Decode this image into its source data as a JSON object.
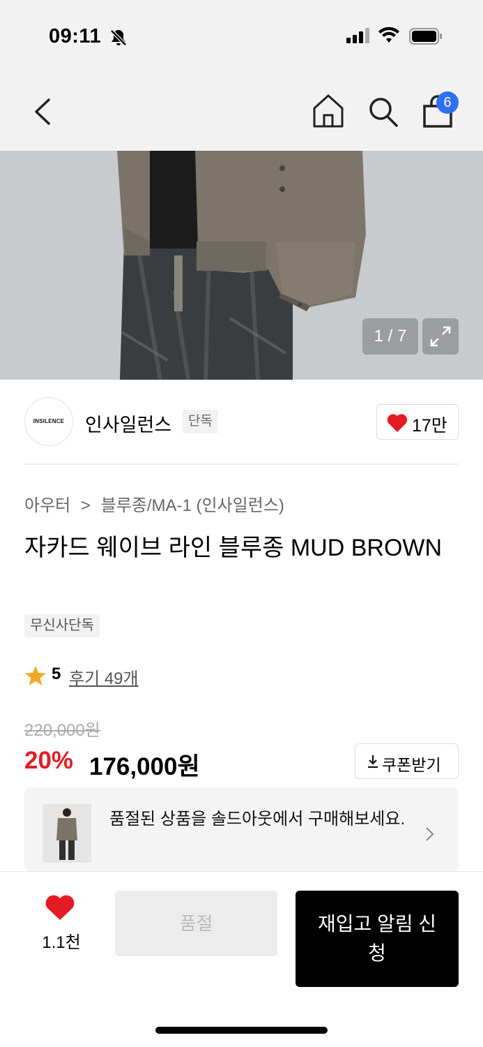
{
  "status_bar": {
    "time": "09:11"
  },
  "nav": {
    "cart_count": "6"
  },
  "gallery": {
    "page_indicator": "1 / 7"
  },
  "brand": {
    "logo_text": "INSILENCE",
    "name": "인사일런스",
    "tag": "단독",
    "like_count": "17만"
  },
  "product": {
    "breadcrumb": [
      "아우터",
      "블루종/MA-1 (인사일런스)"
    ],
    "breadcrumb_separator": ">",
    "title": "자카드 웨이브 라인 블루종 MUD BROWN",
    "badge": "무신사단독",
    "rating": "5",
    "reviews_label": "후기 49개",
    "original_price": "220,000원",
    "discount": "20%",
    "price": "176,000원",
    "coupon_label": "쿠폰받기"
  },
  "soldout_banner": {
    "text": "품절된 상품을 솔드아웃에서 구매해보세요."
  },
  "bottom_bar": {
    "wish_count": "1.1천",
    "soldout_label": "품절",
    "restock_label": "재입고 알림 신청"
  },
  "colors": {
    "accent_red": "#e31c23",
    "badge_blue": "#2f6ff2"
  }
}
